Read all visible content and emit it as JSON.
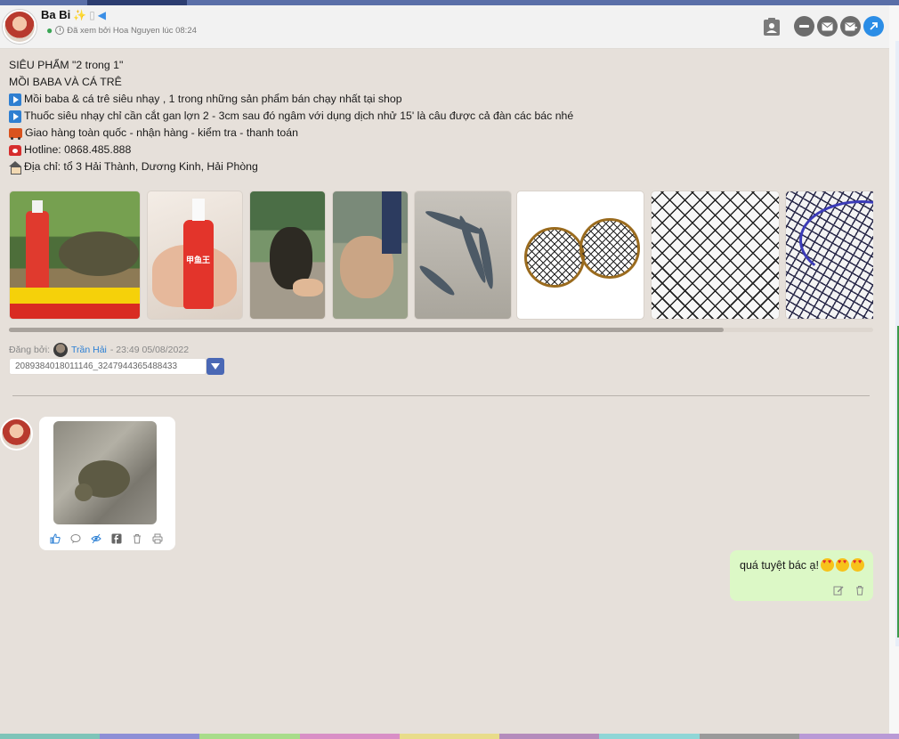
{
  "header": {
    "name": "Ba Bi",
    "seen_text": "Đã xem bởi Hoa Nguyen lúc 08:24",
    "icons": [
      "leaf-icon",
      "cake-icon",
      "megaphone-icon",
      "contact-card-icon",
      "minus-circle-icon",
      "mail-icon",
      "send-mail-icon",
      "open-external-icon"
    ]
  },
  "post": {
    "lines": [
      "SIÊU PHẨM \"2 trong 1\"",
      "MỒI BABA VÀ CÁ TRÊ",
      "Mồi baba & cá trê siêu nhạy , 1 trong những sản phẩm bán chạy nhất tại shop",
      "Thuốc siêu nhạy chỉ cần cắt gan lợn 2 - 3cm sau đó ngâm với dụng dịch nhử 15' là câu được cả đàn các bác nhé",
      "Giao hàng toàn quốc - nhận hàng - kiểm tra - thanh toán",
      "Hotline: 0868.485.888",
      "Địa chỉ: tổ 3 Hải Thành, Dương Kinh, Hải Phòng"
    ],
    "bottle_label": "甲鱼王",
    "posted_by_label": "Đăng bởi:",
    "author": "Trần Hải",
    "timestamp": "- 23:49 05/08/2022",
    "post_id": "2089384018011146_3247944365488433"
  },
  "comments": {
    "right_text": "quá tuyệt bác ạ!"
  },
  "colors": {
    "panel_bg": "#e6e0da",
    "accent_blue": "#2b7fd4",
    "bubble_green": "#dcf8c6",
    "bottom_bar": [
      "#7ec4b8",
      "#8d8fd6",
      "#a8dc8a",
      "#d98fc6",
      "#e8dc8a",
      "#b48cbc",
      "#8fd6d6",
      "#9a9a9a",
      "#b99ad6"
    ]
  }
}
